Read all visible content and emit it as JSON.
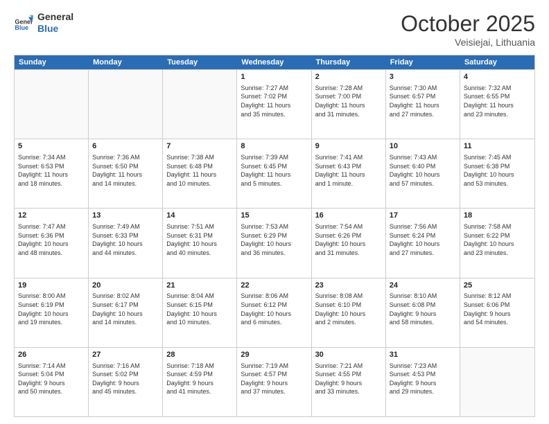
{
  "header": {
    "logo_line1": "General",
    "logo_line2": "Blue",
    "month": "October 2025",
    "location": "Veisiejai, Lithuania"
  },
  "weekdays": [
    "Sunday",
    "Monday",
    "Tuesday",
    "Wednesday",
    "Thursday",
    "Friday",
    "Saturday"
  ],
  "rows": [
    [
      {
        "day": "",
        "info": ""
      },
      {
        "day": "",
        "info": ""
      },
      {
        "day": "",
        "info": ""
      },
      {
        "day": "1",
        "info": "Sunrise: 7:27 AM\nSunset: 7:02 PM\nDaylight: 11 hours\nand 35 minutes."
      },
      {
        "day": "2",
        "info": "Sunrise: 7:28 AM\nSunset: 7:00 PM\nDaylight: 11 hours\nand 31 minutes."
      },
      {
        "day": "3",
        "info": "Sunrise: 7:30 AM\nSunset: 6:57 PM\nDaylight: 11 hours\nand 27 minutes."
      },
      {
        "day": "4",
        "info": "Sunrise: 7:32 AM\nSunset: 6:55 PM\nDaylight: 11 hours\nand 23 minutes."
      }
    ],
    [
      {
        "day": "5",
        "info": "Sunrise: 7:34 AM\nSunset: 6:53 PM\nDaylight: 11 hours\nand 18 minutes."
      },
      {
        "day": "6",
        "info": "Sunrise: 7:36 AM\nSunset: 6:50 PM\nDaylight: 11 hours\nand 14 minutes."
      },
      {
        "day": "7",
        "info": "Sunrise: 7:38 AM\nSunset: 6:48 PM\nDaylight: 11 hours\nand 10 minutes."
      },
      {
        "day": "8",
        "info": "Sunrise: 7:39 AM\nSunset: 6:45 PM\nDaylight: 11 hours\nand 5 minutes."
      },
      {
        "day": "9",
        "info": "Sunrise: 7:41 AM\nSunset: 6:43 PM\nDaylight: 11 hours\nand 1 minute."
      },
      {
        "day": "10",
        "info": "Sunrise: 7:43 AM\nSunset: 6:40 PM\nDaylight: 10 hours\nand 57 minutes."
      },
      {
        "day": "11",
        "info": "Sunrise: 7:45 AM\nSunset: 6:38 PM\nDaylight: 10 hours\nand 53 minutes."
      }
    ],
    [
      {
        "day": "12",
        "info": "Sunrise: 7:47 AM\nSunset: 6:36 PM\nDaylight: 10 hours\nand 48 minutes."
      },
      {
        "day": "13",
        "info": "Sunrise: 7:49 AM\nSunset: 6:33 PM\nDaylight: 10 hours\nand 44 minutes."
      },
      {
        "day": "14",
        "info": "Sunrise: 7:51 AM\nSunset: 6:31 PM\nDaylight: 10 hours\nand 40 minutes."
      },
      {
        "day": "15",
        "info": "Sunrise: 7:53 AM\nSunset: 6:29 PM\nDaylight: 10 hours\nand 36 minutes."
      },
      {
        "day": "16",
        "info": "Sunrise: 7:54 AM\nSunset: 6:26 PM\nDaylight: 10 hours\nand 31 minutes."
      },
      {
        "day": "17",
        "info": "Sunrise: 7:56 AM\nSunset: 6:24 PM\nDaylight: 10 hours\nand 27 minutes."
      },
      {
        "day": "18",
        "info": "Sunrise: 7:58 AM\nSunset: 6:22 PM\nDaylight: 10 hours\nand 23 minutes."
      }
    ],
    [
      {
        "day": "19",
        "info": "Sunrise: 8:00 AM\nSunset: 6:19 PM\nDaylight: 10 hours\nand 19 minutes."
      },
      {
        "day": "20",
        "info": "Sunrise: 8:02 AM\nSunset: 6:17 PM\nDaylight: 10 hours\nand 14 minutes."
      },
      {
        "day": "21",
        "info": "Sunrise: 8:04 AM\nSunset: 6:15 PM\nDaylight: 10 hours\nand 10 minutes."
      },
      {
        "day": "22",
        "info": "Sunrise: 8:06 AM\nSunset: 6:12 PM\nDaylight: 10 hours\nand 6 minutes."
      },
      {
        "day": "23",
        "info": "Sunrise: 8:08 AM\nSunset: 6:10 PM\nDaylight: 10 hours\nand 2 minutes."
      },
      {
        "day": "24",
        "info": "Sunrise: 8:10 AM\nSunset: 6:08 PM\nDaylight: 9 hours\nand 58 minutes."
      },
      {
        "day": "25",
        "info": "Sunrise: 8:12 AM\nSunset: 6:06 PM\nDaylight: 9 hours\nand 54 minutes."
      }
    ],
    [
      {
        "day": "26",
        "info": "Sunrise: 7:14 AM\nSunset: 5:04 PM\nDaylight: 9 hours\nand 50 minutes."
      },
      {
        "day": "27",
        "info": "Sunrise: 7:16 AM\nSunset: 5:02 PM\nDaylight: 9 hours\nand 45 minutes."
      },
      {
        "day": "28",
        "info": "Sunrise: 7:18 AM\nSunset: 4:59 PM\nDaylight: 9 hours\nand 41 minutes."
      },
      {
        "day": "29",
        "info": "Sunrise: 7:19 AM\nSunset: 4:57 PM\nDaylight: 9 hours\nand 37 minutes."
      },
      {
        "day": "30",
        "info": "Sunrise: 7:21 AM\nSunset: 4:55 PM\nDaylight: 9 hours\nand 33 minutes."
      },
      {
        "day": "31",
        "info": "Sunrise: 7:23 AM\nSunset: 4:53 PM\nDaylight: 9 hours\nand 29 minutes."
      },
      {
        "day": "",
        "info": ""
      }
    ]
  ]
}
